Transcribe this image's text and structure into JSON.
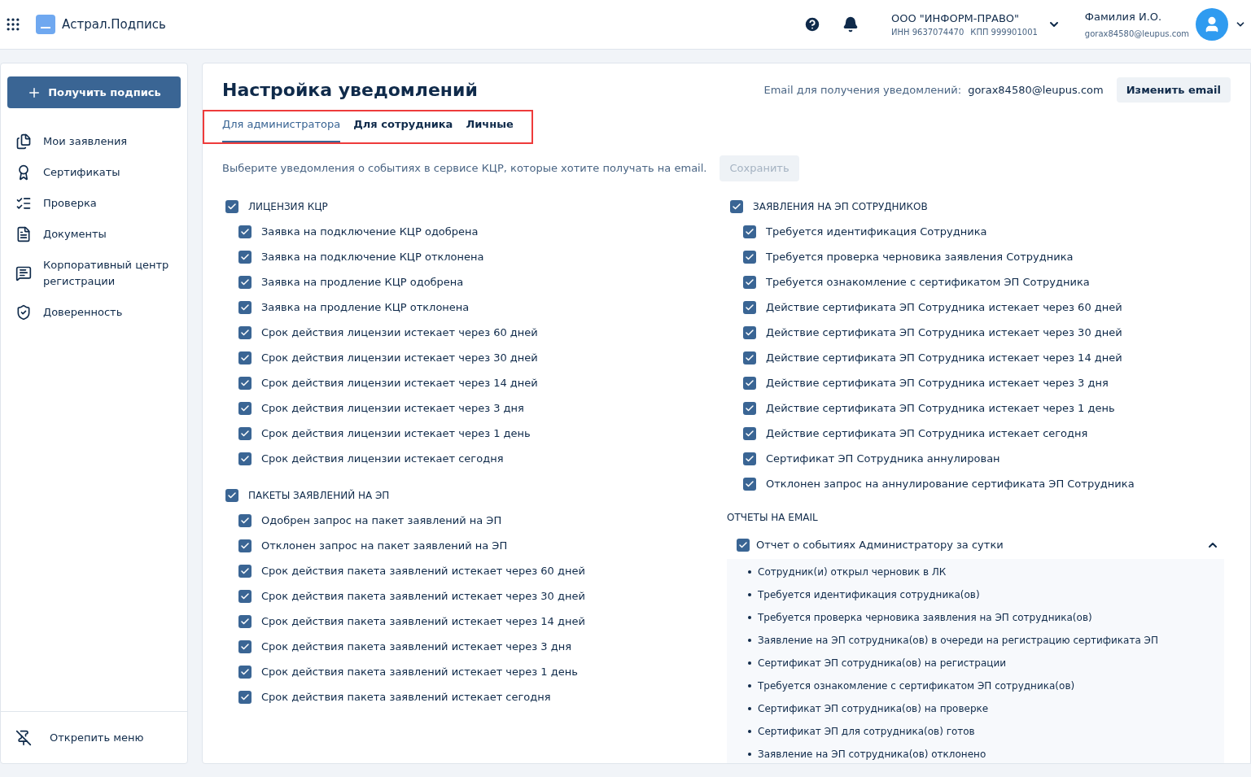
{
  "header": {
    "app_name": "Астрал.Подпись",
    "org_name": "ООО \"ИНФОРМ-ПРАВО\"",
    "org_inn": "ИНН 9637074470",
    "org_kpp": "КПП 999901001",
    "user_name": "Фамилия И.О.",
    "user_email": "gorax84580@leupus.com"
  },
  "sidebar": {
    "primary_button": "Получить подпись",
    "items": [
      {
        "label": "Мои заявления",
        "kind": "files"
      },
      {
        "label": "Сертификаты",
        "kind": "award"
      },
      {
        "label": "Проверка",
        "kind": "check"
      },
      {
        "label": "Документы",
        "kind": "document"
      },
      {
        "label": "Корпоративный центр регистрации",
        "kind": "chat"
      },
      {
        "label": "Доверенность",
        "kind": "shield"
      }
    ],
    "footer_button": "Открепить меню"
  },
  "page": {
    "title": "Настройка уведомлений",
    "email_label": "Email для получения уведомлений:",
    "email_value": "gorax84580@leupus.com",
    "change_email_button": "Изменить email",
    "tabs": [
      {
        "label": "Для администратора",
        "selected": true
      },
      {
        "label": "Для сотрудника",
        "selected": false
      },
      {
        "label": "Личные",
        "selected": false
      }
    ],
    "description": "Выберите уведомления о событиях в сервисе КЦР, которые хотите получать на email.",
    "save_button": {
      "label": "Сохранить",
      "disabled": true
    },
    "left_groups": [
      {
        "title": "ЛИЦЕНЗИЯ КЦР",
        "checked": true,
        "items": [
          {
            "label": "Заявка на подключение КЦР одобрена",
            "checked": true
          },
          {
            "label": "Заявка на подключение КЦР отклонена",
            "checked": true
          },
          {
            "label": "Заявка на продление КЦР одобрена",
            "checked": true
          },
          {
            "label": "Заявка на продление КЦР отклонена",
            "checked": true
          },
          {
            "label": "Срок действия лицензии истекает через 60 дней",
            "checked": true
          },
          {
            "label": "Срок действия лицензии истекает через 30 дней",
            "checked": true
          },
          {
            "label": "Срок действия лицензии истекает через 14 дней",
            "checked": true
          },
          {
            "label": "Срок действия лицензии истекает через 3 дня",
            "checked": true
          },
          {
            "label": "Срок действия лицензии истекает через 1 день",
            "checked": true
          },
          {
            "label": "Срок действия лицензии истекает сегодня",
            "checked": true
          }
        ]
      },
      {
        "title": "ПАКЕТЫ ЗАЯВЛЕНИЙ НА ЭП",
        "checked": true,
        "items": [
          {
            "label": "Одобрен запрос на пакет заявлений на ЭП",
            "checked": true
          },
          {
            "label": "Отклонен запрос на пакет заявлений на ЭП",
            "checked": true
          },
          {
            "label": "Срок действия пакета заявлений истекает через 60 дней",
            "checked": true
          },
          {
            "label": "Срок действия пакета заявлений истекает через 30 дней",
            "checked": true
          },
          {
            "label": "Срок действия пакета заявлений истекает через 14 дней",
            "checked": true
          },
          {
            "label": "Срок действия пакета заявлений истекает через 3 дня",
            "checked": true
          },
          {
            "label": "Срок действия пакета заявлений истекает через 1 день",
            "checked": true
          },
          {
            "label": "Срок действия пакета заявлений истекает сегодня",
            "checked": true
          }
        ]
      }
    ],
    "right_groups": [
      {
        "title": "ЗАЯВЛЕНИЯ НА ЭП СОТРУДНИКОВ",
        "checked": true,
        "items": [
          {
            "label": "Требуется идентификация Сотрудника",
            "checked": true
          },
          {
            "label": "Требуется проверка черновика заявления Сотрудника",
            "checked": true
          },
          {
            "label": "Требуется ознакомление с сертификатом ЭП Сотрудника",
            "checked": true
          },
          {
            "label": "Действие сертификата ЭП Сотрудника истекает через 60 дней",
            "checked": true
          },
          {
            "label": "Действие сертификата ЭП Сотрудника истекает через 30 дней",
            "checked": true
          },
          {
            "label": "Действие сертификата ЭП Сотрудника истекает через 14 дней",
            "checked": true
          },
          {
            "label": "Действие сертификата ЭП Сотрудника истекает через 3 дня",
            "checked": true
          },
          {
            "label": "Действие сертификата ЭП Сотрудника истекает через 1 день",
            "checked": true
          },
          {
            "label": "Действие сертификата ЭП Сотрудника истекает сегодня",
            "checked": true
          },
          {
            "label": "Сертификат ЭП Сотрудника аннулирован",
            "checked": true
          },
          {
            "label": "Отклонен запрос на аннулирование сертификата ЭП Сотрудника",
            "checked": true
          }
        ]
      }
    ],
    "reports": {
      "title": "ОТЧЕТЫ НА EMAIL",
      "report": {
        "label": "Отчет о событиях Администратору за сутки",
        "checked": true,
        "expanded": true,
        "bullets": [
          "Сотрудник(и) открыл черновик в ЛК",
          "Требуется идентификация сотрудника(ов)",
          "Требуется проверка черновика заявления на ЭП сотрудника(ов)",
          "Заявление на ЭП сотрудника(ов) в очереди на регистрацию сертификата ЭП",
          "Сертификат ЭП сотрудника(ов) на регистрации",
          "Требуется ознакомление с сертификатом ЭП сотрудника(ов)",
          "Сертификат ЭП сотрудника(ов) на проверке",
          "Сертификат ЭП для сотрудника(ов) готов",
          "Заявление на ЭП сотрудника(ов) отклонено"
        ]
      }
    }
  }
}
